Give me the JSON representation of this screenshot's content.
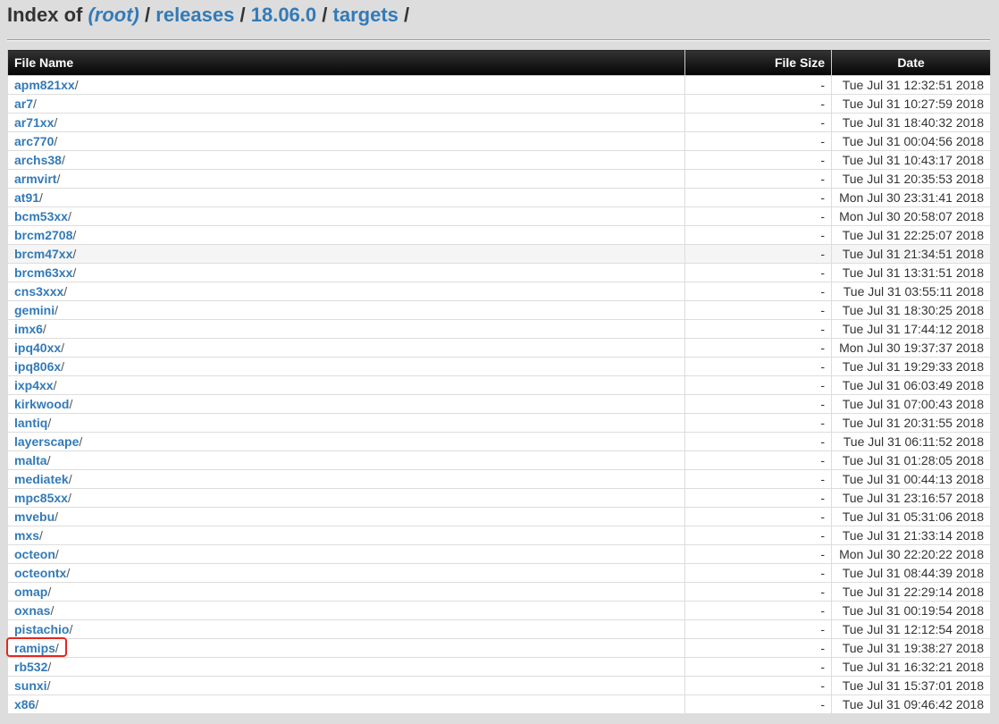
{
  "heading": {
    "prefix": "Index of",
    "root": "(root)",
    "sep": "/",
    "crumbs": [
      "releases",
      "18.06.0",
      "targets"
    ]
  },
  "table": {
    "headers": {
      "name": "File Name",
      "size": "File Size",
      "date": "Date"
    },
    "rows": [
      {
        "name": "apm821xx",
        "size": "-",
        "date": "Tue Jul 31 12:32:51 2018"
      },
      {
        "name": "ar7",
        "size": "-",
        "date": "Tue Jul 31 10:27:59 2018"
      },
      {
        "name": "ar71xx",
        "size": "-",
        "date": "Tue Jul 31 18:40:32 2018"
      },
      {
        "name": "arc770",
        "size": "-",
        "date": "Tue Jul 31 00:04:56 2018"
      },
      {
        "name": "archs38",
        "size": "-",
        "date": "Tue Jul 31 10:43:17 2018"
      },
      {
        "name": "armvirt",
        "size": "-",
        "date": "Tue Jul 31 20:35:53 2018"
      },
      {
        "name": "at91",
        "size": "-",
        "date": "Mon Jul 30 23:31:41 2018"
      },
      {
        "name": "bcm53xx",
        "size": "-",
        "date": "Mon Jul 30 20:58:07 2018"
      },
      {
        "name": "brcm2708",
        "size": "-",
        "date": "Tue Jul 31 22:25:07 2018"
      },
      {
        "name": "brcm47xx",
        "size": "-",
        "date": "Tue Jul 31 21:34:51 2018"
      },
      {
        "name": "brcm63xx",
        "size": "-",
        "date": "Tue Jul 31 13:31:51 2018"
      },
      {
        "name": "cns3xxx",
        "size": "-",
        "date": "Tue Jul 31 03:55:11 2018"
      },
      {
        "name": "gemini",
        "size": "-",
        "date": "Tue Jul 31 18:30:25 2018"
      },
      {
        "name": "imx6",
        "size": "-",
        "date": "Tue Jul 31 17:44:12 2018"
      },
      {
        "name": "ipq40xx",
        "size": "-",
        "date": "Mon Jul 30 19:37:37 2018"
      },
      {
        "name": "ipq806x",
        "size": "-",
        "date": "Tue Jul 31 19:29:33 2018"
      },
      {
        "name": "ixp4xx",
        "size": "-",
        "date": "Tue Jul 31 06:03:49 2018"
      },
      {
        "name": "kirkwood",
        "size": "-",
        "date": "Tue Jul 31 07:00:43 2018"
      },
      {
        "name": "lantiq",
        "size": "-",
        "date": "Tue Jul 31 20:31:55 2018"
      },
      {
        "name": "layerscape",
        "size": "-",
        "date": "Tue Jul 31 06:11:52 2018"
      },
      {
        "name": "malta",
        "size": "-",
        "date": "Tue Jul 31 01:28:05 2018"
      },
      {
        "name": "mediatek",
        "size": "-",
        "date": "Tue Jul 31 00:44:13 2018"
      },
      {
        "name": "mpc85xx",
        "size": "-",
        "date": "Tue Jul 31 23:16:57 2018"
      },
      {
        "name": "mvebu",
        "size": "-",
        "date": "Tue Jul 31 05:31:06 2018"
      },
      {
        "name": "mxs",
        "size": "-",
        "date": "Tue Jul 31 21:33:14 2018"
      },
      {
        "name": "octeon",
        "size": "-",
        "date": "Mon Jul 30 22:20:22 2018"
      },
      {
        "name": "octeontx",
        "size": "-",
        "date": "Tue Jul 31 08:44:39 2018"
      },
      {
        "name": "omap",
        "size": "-",
        "date": "Tue Jul 31 22:29:14 2018"
      },
      {
        "name": "oxnas",
        "size": "-",
        "date": "Tue Jul 31 00:19:54 2018"
      },
      {
        "name": "pistachio",
        "size": "-",
        "date": "Tue Jul 31 12:12:54 2018"
      },
      {
        "name": "ramips",
        "size": "-",
        "date": "Tue Jul 31 19:38:27 2018"
      },
      {
        "name": "rb532",
        "size": "-",
        "date": "Tue Jul 31 16:32:21 2018"
      },
      {
        "name": "sunxi",
        "size": "-",
        "date": "Tue Jul 31 15:37:01 2018"
      },
      {
        "name": "x86",
        "size": "-",
        "date": "Tue Jul 31 09:46:42 2018"
      }
    ],
    "dir_suffix": "/",
    "highlighted_row": "ramips"
  },
  "colors": {
    "link": "#337ab7",
    "background": "#dddddd",
    "header_bg": "#050505",
    "highlight_border": "#e8251e"
  }
}
